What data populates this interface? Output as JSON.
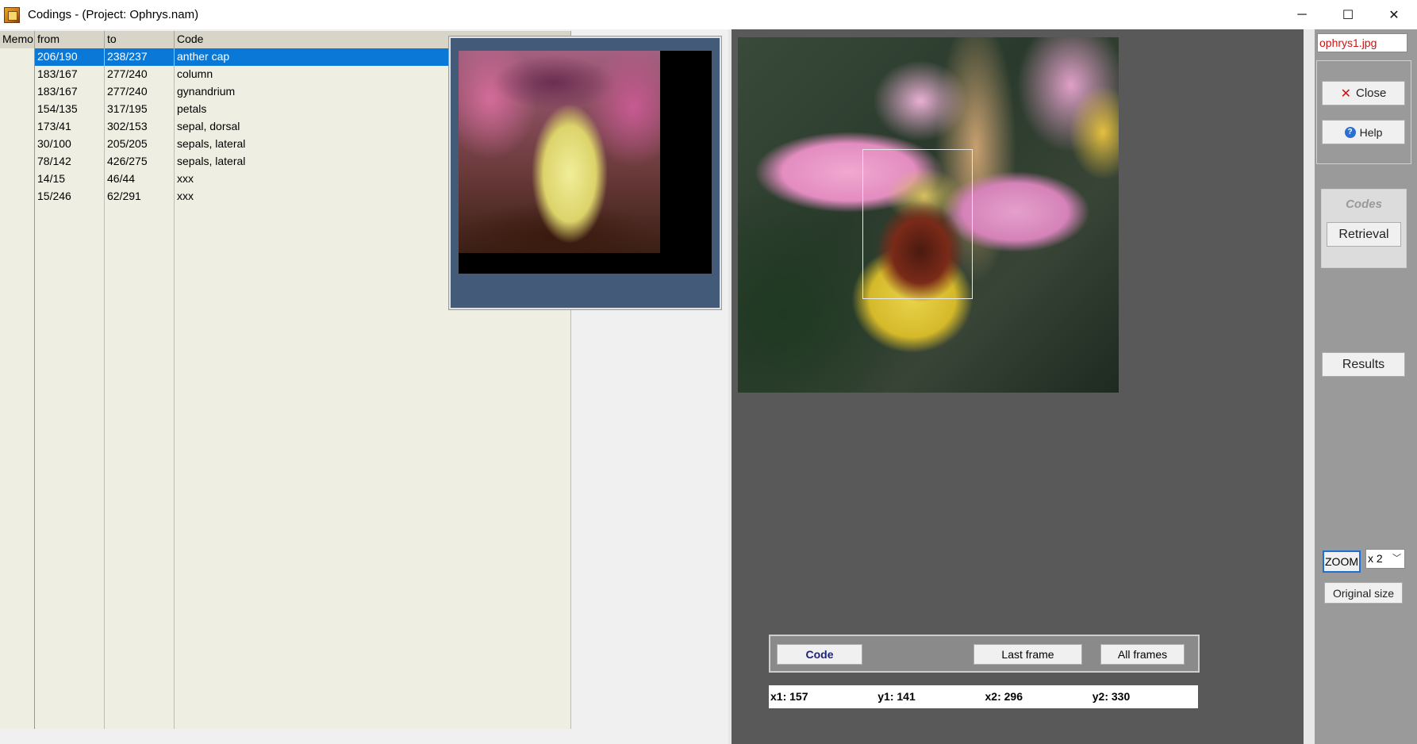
{
  "window": {
    "title": "Codings -  (Project: Ophrys.nam)",
    "minimize_glyph": "─",
    "maximize_glyph": "☐",
    "close_glyph": "✕"
  },
  "grid": {
    "headers": {
      "memo": "Memo",
      "from": "from",
      "to": "to",
      "code": "Code"
    },
    "rows": [
      {
        "from": "206/190",
        "to": "238/237",
        "code": "anther cap",
        "selected": true
      },
      {
        "from": "183/167",
        "to": "277/240",
        "code": "column"
      },
      {
        "from": "183/167",
        "to": "277/240",
        "code": "gynandrium"
      },
      {
        "from": "154/135",
        "to": "317/195",
        "code": "petals"
      },
      {
        "from": "173/41",
        "to": "302/153",
        "code": "sepal, dorsal"
      },
      {
        "from": "30/100",
        "to": "205/205",
        "code": "sepals, lateral"
      },
      {
        "from": "78/142",
        "to": "426/275",
        "code": "sepals, lateral"
      },
      {
        "from": "14/15",
        "to": "46/44",
        "code": "xxx"
      },
      {
        "from": "15/246",
        "to": "62/291",
        "code": "xxx"
      }
    ],
    "empty_rows": 30
  },
  "code_bar": {
    "code_label": "Code",
    "last_frame_label": "Last frame",
    "all_frames_label": "All frames"
  },
  "coords": {
    "x1": "x1: 157",
    "y1": "y1: 141",
    "x2": "x2: 296",
    "y2": "y2: 330"
  },
  "sidebar": {
    "file_name": "ophrys1.jpg",
    "close_label": "Close",
    "help_label": "Help",
    "codes_label": "Codes",
    "retrieval_label": "Retrieval",
    "results_label": "Results",
    "zoom_label": "ZOOM",
    "zoom_value": "x 2",
    "original_size_label": "Original size"
  },
  "colors": {
    "selection": "#0a78d7",
    "memo_column": "#92c083",
    "image_panel_bg": "#595959",
    "preview_frame": "#435a78",
    "file_name_text": "#cc1111"
  }
}
